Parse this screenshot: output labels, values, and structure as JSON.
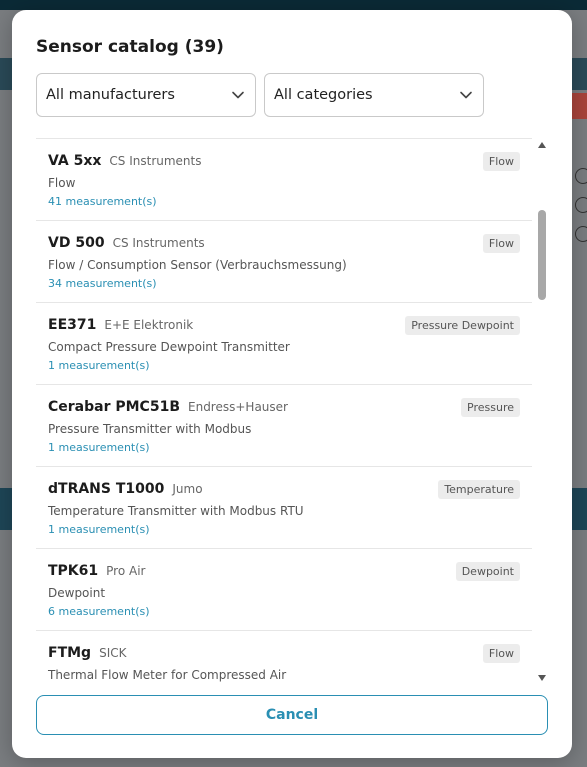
{
  "dialog": {
    "title": "Sensor catalog (39)",
    "cancel_label": "Cancel"
  },
  "filters": {
    "manufacturer": "All manufacturers",
    "category": "All categories"
  },
  "sensors": [
    {
      "name": "VA 5xx",
      "manufacturer": "CS Instruments",
      "description": "Flow",
      "measurements": "41 measurement(s)",
      "category": "Flow"
    },
    {
      "name": "VD 500",
      "manufacturer": "CS Instruments",
      "description": "Flow / Consumption Sensor (Verbrauchsmessung)",
      "measurements": "34 measurement(s)",
      "category": "Flow"
    },
    {
      "name": "EE371",
      "manufacturer": "E+E Elektronik",
      "description": "Compact Pressure Dewpoint Transmitter",
      "measurements": "1 measurement(s)",
      "category": "Pressure Dewpoint"
    },
    {
      "name": "Cerabar PMC51B",
      "manufacturer": "Endress+Hauser",
      "description": "Pressure Transmitter with Modbus",
      "measurements": "1 measurement(s)",
      "category": "Pressure"
    },
    {
      "name": "dTRANS T1000",
      "manufacturer": "Jumo",
      "description": "Temperature Transmitter with Modbus RTU",
      "measurements": "1 measurement(s)",
      "category": "Temperature"
    },
    {
      "name": "TPK61",
      "manufacturer": "Pro Air",
      "description": "Dewpoint",
      "measurements": "6 measurement(s)",
      "category": "Dewpoint"
    },
    {
      "name": "FTMg",
      "manufacturer": "SICK",
      "description": "Thermal Flow Meter for Compressed Air",
      "measurements": "",
      "category": "Flow"
    }
  ],
  "colors": {
    "accent": "#2a8fb3",
    "badge_bg": "#ececec",
    "overlay": "#7a7d80"
  }
}
